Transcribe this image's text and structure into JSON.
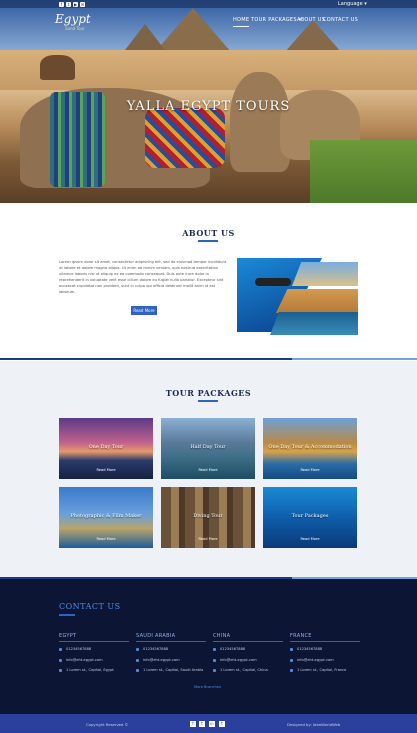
{
  "header": {
    "language_label": "Language ▾",
    "logo_text": "Egypt",
    "logo_sub": "Sand Tour",
    "nav": [
      {
        "label": "HOME"
      },
      {
        "label": "TOUR PACKAGES ▾"
      },
      {
        "label": "ABOUT US"
      },
      {
        "label": "CONTACT US"
      }
    ],
    "social": [
      "f",
      "t",
      "▶",
      "✉"
    ]
  },
  "hero": {
    "title": "YALLA EGYPT TOURS"
  },
  "about": {
    "title": "ABOUT US",
    "text": "Lorem ipsum dolor sit amet, consectetur adipiscing elit, sed do eiusmod tempor incididunt ut labore et dolore magna aliqua. Ut enim ad minim veniam, quis nostrud exercitation ullamco laboris nisi ut aliquip ex ea commodo consequat. Duis aute irure dolor in reprehenderit in voluptate velit esse cillum dolore eu fugiat nulla pariatur. Excepteur sint occaecat cupidatat non proident, sunt in culpa qui officia deserunt mollit anim id est laborum.",
    "button": "Read More"
  },
  "packages": {
    "title": "TOUR PACKAGES",
    "cards": [
      {
        "title": "One Day Tour",
        "button": "Read More"
      },
      {
        "title": "Half Day Tour",
        "button": "Read More"
      },
      {
        "title": "One Day Tour & Accommodation",
        "button": "Read More"
      },
      {
        "title": "Photographic & Film Maker",
        "button": "Read More"
      },
      {
        "title": "Diving Tour",
        "button": "Read More"
      },
      {
        "title": "Tour Packages",
        "button": "Read More"
      }
    ]
  },
  "contact": {
    "title": "CONTACT US",
    "columns": [
      {
        "country": "EGYPT",
        "phone": "01234567888",
        "email": "info@eht-egypt.com",
        "address": "1 Lorem st., Capital, Egypt"
      },
      {
        "country": "SAUDI ARABIA",
        "phone": "01234567888",
        "email": "info@eht-egypt.com",
        "address": "1 Lorem st., Capital, Saudi Arabia"
      },
      {
        "country": "CHINA",
        "phone": "01234567888",
        "email": "info@eht-egypt.com",
        "address": "1 Lorem st., Capital, China"
      },
      {
        "country": "FRANCE",
        "phone": "01234567888",
        "email": "info@eht-egypt.com",
        "address": "1 Lorem st., Capital, France"
      }
    ],
    "more_link": "More Branches"
  },
  "footer": {
    "copyright": "Copyright Reserved ©",
    "designed_by": "Designed by: IdeaWorldWeb",
    "social": [
      "f",
      "t",
      "in",
      "t"
    ]
  },
  "colors": {
    "accent": "#2e62c4",
    "contact_bg": "#0c1533",
    "footer_bg": "#2b3f9c"
  }
}
